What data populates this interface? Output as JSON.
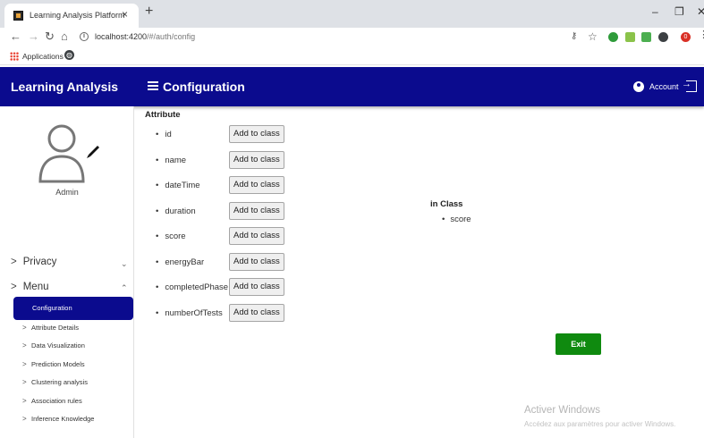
{
  "browser": {
    "tab_title": "Learning Analysis Platform",
    "tab_close": "×",
    "new_tab": "+",
    "url_host": "localhost:4200",
    "url_path": "/#/auth/config",
    "profile_initial": "0",
    "bookmarks": {
      "apps_label": "Applications"
    }
  },
  "header": {
    "brand": "Learning Analysis",
    "page_title": "Configuration",
    "account_label": "Account"
  },
  "sidebar": {
    "user_name": "Admin",
    "sections": [
      {
        "label": "Privacy",
        "state": "collapsed"
      },
      {
        "label": "Menu",
        "state": "expanded"
      }
    ],
    "active_item": "Configuration",
    "sub_items": [
      "Attribute Details",
      "Data Visualization",
      "Prediction Models",
      "Clustering analysis",
      "Association rules",
      "Inference Knowledge"
    ]
  },
  "main": {
    "attribute_heading": "Attribute",
    "add_button_label": "Add to class",
    "attributes": [
      "id",
      "name",
      "dateTime",
      "duration",
      "score",
      "energyBar",
      "completedPhase",
      "numberOfTests"
    ],
    "in_class_heading": "in Class",
    "in_class_items": [
      "score"
    ],
    "exit_label": "Exit"
  },
  "watermark": {
    "title": "Activer Windows",
    "subtitle": "Accédez aux paramètres pour activer Windows."
  },
  "colors": {
    "primary": "#0b0b8e",
    "exit": "#0f8a0f"
  }
}
